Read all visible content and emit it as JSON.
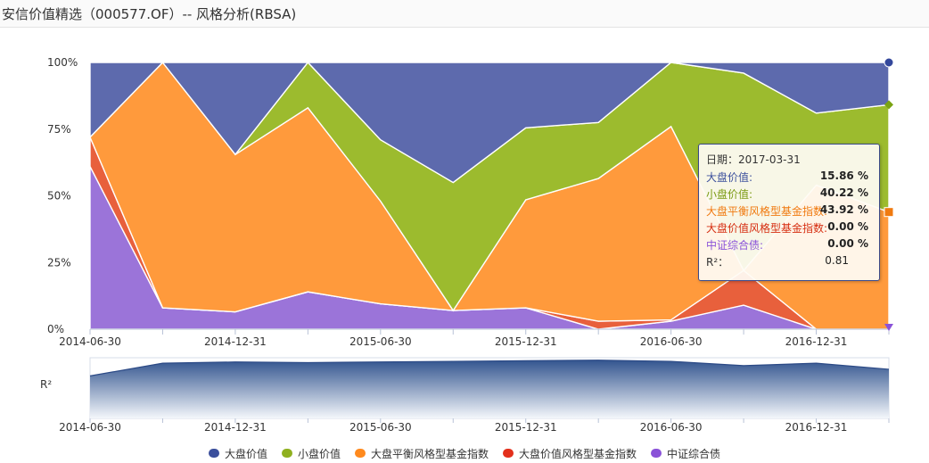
{
  "page": {
    "title": "安信价值精选（000577.OF）-- 风格分析(RBSA)"
  },
  "chart_data": {
    "type": "area",
    "stacked": true,
    "x": [
      "2014-06-30",
      "2014-09-30",
      "2014-12-31",
      "2015-03-31",
      "2015-06-30",
      "2015-09-30",
      "2015-12-31",
      "2016-03-31",
      "2016-06-30",
      "2016-09-30",
      "2016-12-31",
      "2017-03-31"
    ],
    "x_tick_labels": [
      "2014-06-30",
      "2014-12-31",
      "2015-06-30",
      "2015-12-31",
      "2016-06-30",
      "2016-12-31"
    ],
    "y_ticks": [
      "0%",
      "25%",
      "50%",
      "75%",
      "100%"
    ],
    "ylim": [
      0,
      100
    ],
    "series": [
      {
        "name": "中证综合债",
        "color": "#9b74d9",
        "values": [
          61,
          8,
          6.5,
          14,
          9.5,
          7,
          8,
          0,
          3,
          9,
          0,
          0
        ]
      },
      {
        "name": "大盘价值风格型基金指数",
        "color": "#e8603c",
        "values": [
          11,
          0,
          0,
          0,
          0,
          0,
          0,
          3,
          0.5,
          13,
          0,
          0
        ]
      },
      {
        "name": "大盘平衡风格型基金指数",
        "color": "#ff9a3c",
        "values": [
          0,
          92,
          59,
          69,
          38.5,
          0,
          40.5,
          53.5,
          72.5,
          0,
          54,
          43.92
        ]
      },
      {
        "name": "小盘价值",
        "color": "#9cbb2e",
        "values": [
          0,
          0,
          0,
          17,
          23,
          48,
          27,
          21,
          24,
          74,
          27,
          40.22
        ]
      },
      {
        "name": "大盘价值",
        "color": "#5d6aad",
        "values": [
          28,
          0,
          34.5,
          0,
          29,
          45,
          24.5,
          22.5,
          0,
          4,
          19,
          15.86
        ]
      }
    ],
    "r2_label": "R²",
    "r2_values": [
      0.7,
      0.91,
      0.93,
      0.92,
      0.93,
      0.94,
      0.95,
      0.96,
      0.94,
      0.87,
      0.91,
      0.81
    ]
  },
  "tooltip": {
    "date_label": "日期：2017-03-31",
    "rows": [
      {
        "label": "大盘价值:",
        "value": "15.86 %",
        "color": "#3b4f9c"
      },
      {
        "label": "小盘价值:",
        "value": "40.22 %",
        "color": "#7a9a12"
      },
      {
        "label": "大盘平衡风格型基金指数:",
        "value": "43.92 %",
        "color": "#f07a10"
      },
      {
        "label": "大盘价值风格型基金指数:",
        "value": "0.00 %",
        "color": "#d62d10"
      },
      {
        "label": "中证综合债:",
        "value": "0.00 %",
        "color": "#8a52d8"
      },
      {
        "label": "R²：",
        "value": "0.81",
        "color": "#333333"
      }
    ]
  },
  "legend": [
    {
      "label": "大盘价值",
      "color": "#3b4f9c"
    },
    {
      "label": "小盘价值",
      "color": "#8fb01f"
    },
    {
      "label": "大盘平衡风格型基金指数",
      "color": "#ff8a1e"
    },
    {
      "label": "大盘价值风格型基金指数",
      "color": "#e3301c"
    },
    {
      "label": "中证综合债",
      "color": "#8a52d8"
    }
  ],
  "markers": {
    "top_color": "#34489c",
    "diamond_color": "#7aa312",
    "square_color": "#f07a10",
    "triangle_color": "#8a52d8"
  }
}
